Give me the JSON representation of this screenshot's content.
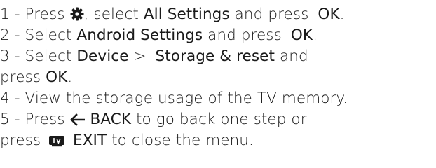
{
  "steps": [
    {
      "num": "1",
      "sep": " - ",
      "press": "Press",
      "icon": "gear-icon",
      "mid": ", select",
      "term1": "All Settings",
      "and_press": "and press",
      "ok": "OK",
      "end": "."
    },
    {
      "num": "2",
      "sep": " - ",
      "select": "Select",
      "term": "Android Settings",
      "and_press": "and press",
      "ok": "OK",
      "end": "."
    },
    {
      "num": "3",
      "sep": " - ",
      "select": "Select",
      "term1": "Device",
      "arrow": ">",
      "term2": "Storage & reset",
      "and": "and",
      "press": "press",
      "ok": "OK",
      "end": "."
    },
    {
      "num": "4",
      "sep": " - ",
      "text": "View the storage usage of the TV memory."
    },
    {
      "num": "5",
      "sep": " - ",
      "press": "Press",
      "back_icon": "left-arrow-icon",
      "back": "BACK",
      "text1": "to go back one step or",
      "press2": "press",
      "tv_icon": "tv-icon",
      "exit": "EXIT",
      "text2": "to close the menu."
    }
  ],
  "colors": {
    "text": "#1a1a1a"
  }
}
